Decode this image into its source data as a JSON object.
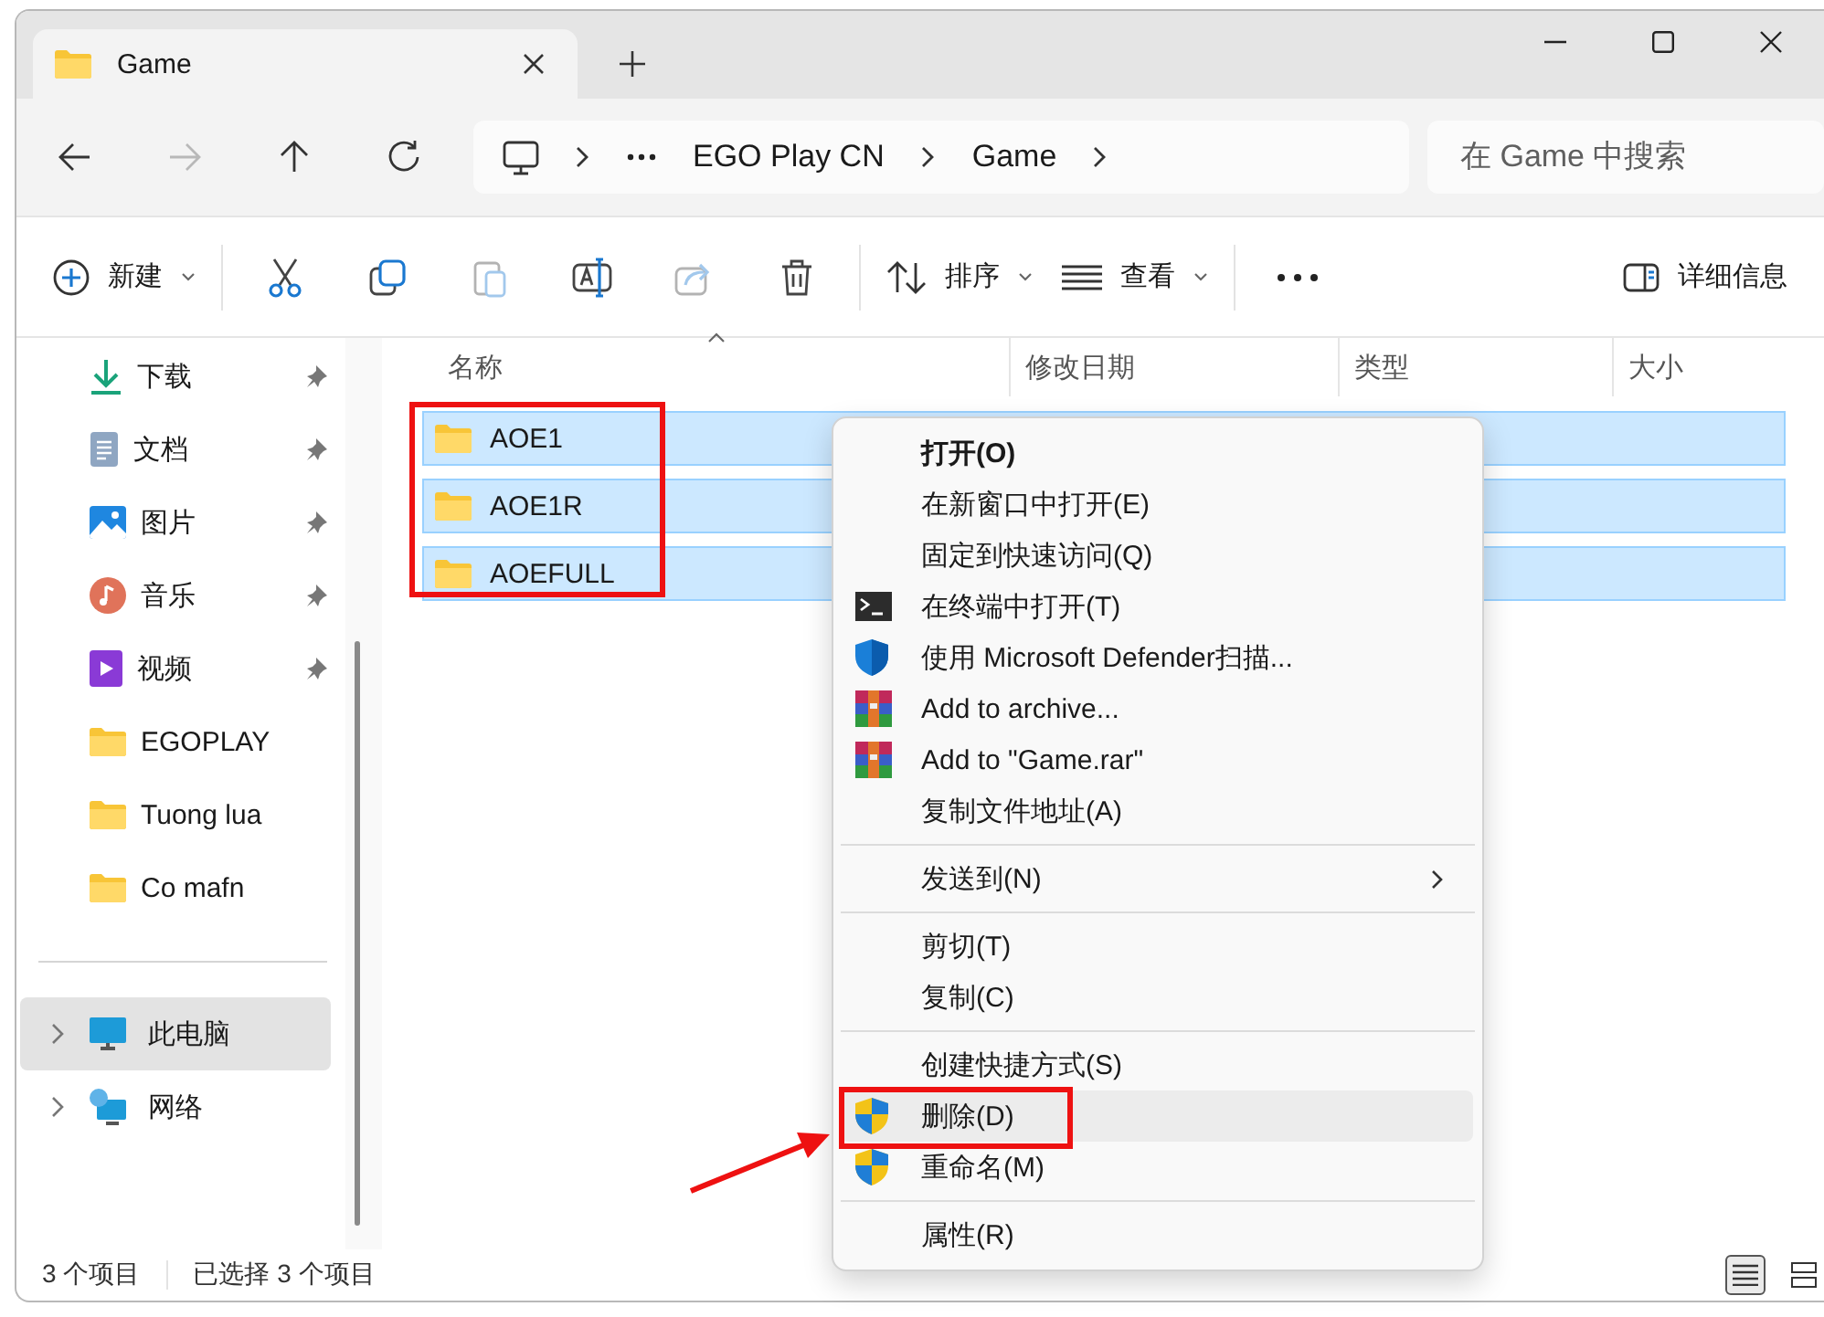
{
  "window": {
    "tab": {
      "title": "Game"
    }
  },
  "nav": {
    "breadcrumb": [
      "EGO Play CN",
      "Game"
    ],
    "search": {
      "placeholder": "在 Game 中搜索"
    }
  },
  "toolbar": [
    {
      "kind": "new",
      "label": "新建",
      "disabled": false
    },
    {
      "kind": "cut",
      "disabled": false
    },
    {
      "kind": "copy",
      "disabled": false
    },
    {
      "kind": "paste",
      "disabled": true
    },
    {
      "kind": "rename",
      "disabled": false
    },
    {
      "kind": "share",
      "disabled": true
    },
    {
      "kind": "delete",
      "disabled": false
    },
    {
      "kind": "sort",
      "label": "排序",
      "disabled": false
    },
    {
      "kind": "view",
      "label": "查看",
      "disabled": false
    },
    {
      "kind": "more",
      "disabled": false
    },
    {
      "kind": "details",
      "label": "详细信息",
      "disabled": false
    }
  ],
  "sidebar": {
    "items": [
      {
        "kind": "download",
        "label": "下载",
        "pinned": true
      },
      {
        "kind": "document",
        "label": "文档",
        "pinned": true
      },
      {
        "kind": "picture",
        "label": "图片",
        "pinned": true
      },
      {
        "kind": "music",
        "label": "音乐",
        "pinned": true
      },
      {
        "kind": "video",
        "label": "视频",
        "pinned": true
      },
      {
        "kind": "folder",
        "label": "EGOPLAY",
        "pinned": false
      },
      {
        "kind": "folder",
        "label": "Tuong lua",
        "pinned": false
      },
      {
        "kind": "folder",
        "label": "Co mafn",
        "pinned": false
      }
    ],
    "locations": [
      {
        "kind": "pc",
        "label": "此电脑",
        "selected": true,
        "expanded": false
      },
      {
        "kind": "network",
        "label": "网络",
        "selected": false,
        "expanded": false
      }
    ]
  },
  "files": {
    "columns": [
      {
        "label": "名称",
        "sorted": true
      },
      {
        "label": "修改日期",
        "sorted": false
      },
      {
        "label": "类型",
        "sorted": false
      },
      {
        "label": "大小",
        "sorted": false
      }
    ],
    "rows": [
      {
        "name": "AOE1",
        "selected": true
      },
      {
        "name": "AOE1R",
        "selected": true
      },
      {
        "name": "AOEFULL",
        "selected": true
      }
    ]
  },
  "context_menu": {
    "sections": [
      [
        {
          "label": "打开(O)",
          "kind": "plain",
          "default": true,
          "highlighted": false,
          "submenu": false
        },
        {
          "label": "在新窗口中打开(E)",
          "kind": "plain",
          "default": false,
          "highlighted": false,
          "submenu": false
        },
        {
          "label": "固定到快速访问(Q)",
          "kind": "plain",
          "default": false,
          "highlighted": false,
          "submenu": false
        },
        {
          "label": "在终端中打开(T)",
          "kind": "terminal",
          "default": false,
          "highlighted": false,
          "submenu": false
        },
        {
          "label": "使用 Microsoft Defender扫描...",
          "kind": "defender",
          "default": false,
          "highlighted": false,
          "submenu": false
        },
        {
          "label": "Add to archive...",
          "kind": "archive",
          "default": false,
          "highlighted": false,
          "submenu": false
        },
        {
          "label": "Add to \"Game.rar\"",
          "kind": "archive",
          "default": false,
          "highlighted": false,
          "submenu": false
        },
        {
          "label": "复制文件地址(A)",
          "kind": "plain",
          "default": false,
          "highlighted": false,
          "submenu": false
        }
      ],
      [
        {
          "label": "发送到(N)",
          "kind": "plain",
          "default": false,
          "highlighted": false,
          "submenu": true
        }
      ],
      [
        {
          "label": "剪切(T)",
          "kind": "plain",
          "default": false,
          "highlighted": false,
          "submenu": false
        },
        {
          "label": "复制(C)",
          "kind": "plain",
          "default": false,
          "highlighted": false,
          "submenu": false
        }
      ],
      [
        {
          "label": "创建快捷方式(S)",
          "kind": "plain",
          "default": false,
          "highlighted": false,
          "submenu": false
        },
        {
          "label": "删除(D)",
          "kind": "admin",
          "default": false,
          "highlighted": true,
          "submenu": false
        },
        {
          "label": "重命名(M)",
          "kind": "admin",
          "default": false,
          "highlighted": false,
          "submenu": false
        }
      ],
      [
        {
          "label": "属性(R)",
          "kind": "plain",
          "default": false,
          "highlighted": false,
          "submenu": false
        }
      ]
    ]
  },
  "status_bar": {
    "item_count": "3 个项目",
    "selection": "已选择 3 个项目",
    "views": [
      {
        "kind": "details",
        "selected": true
      },
      {
        "kind": "tiles",
        "selected": false
      }
    ]
  }
}
